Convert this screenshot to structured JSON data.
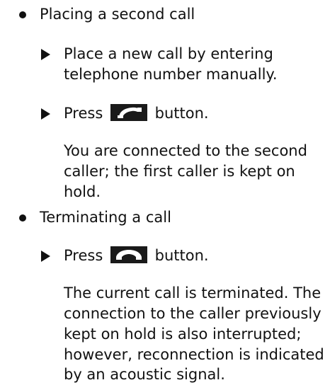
{
  "sections": [
    {
      "heading": "Placing a second call",
      "steps": [
        {
          "line1": "Place a new call by entering",
          "line2": "telephone number manually."
        },
        {
          "before_icon": "Press",
          "icon": "call-accept-icon",
          "after_icon": "button."
        }
      ],
      "result_lines": [
        "You are connected to the second",
        "caller; the first caller is kept on",
        "hold."
      ]
    },
    {
      "heading": "Terminating a call",
      "steps": [
        {
          "before_icon": "Press",
          "icon": "call-end-icon",
          "after_icon": "button."
        }
      ],
      "result_lines": [
        "The current call is terminated. The",
        "connection to the caller previously",
        "kept on hold is also interrupted;",
        "however, reconnection is indicated",
        "by an acoustic signal."
      ]
    }
  ]
}
